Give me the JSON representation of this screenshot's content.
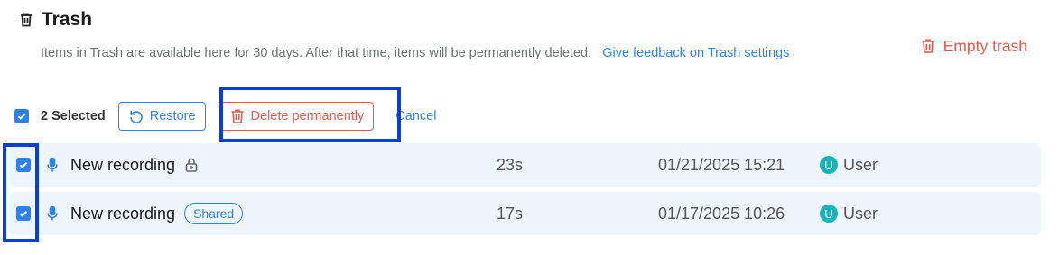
{
  "header": {
    "title": "Trash",
    "description": "Items in Trash are available here for 30 days. After that time, items will be permanently deleted.",
    "feedback_link": "Give feedback on Trash settings",
    "empty_trash_label": "Empty trash",
    "icon": "trash-icon"
  },
  "selection": {
    "count_label": "2 Selected",
    "restore_label": "Restore",
    "delete_label": "Delete permanently",
    "cancel_label": "Cancel"
  },
  "rows": [
    {
      "name": "New recording",
      "tag": "lock-icon",
      "duration": "23s",
      "date": "01/21/2025 15:21",
      "owner_initial": "U",
      "owner": "User",
      "checked": true
    },
    {
      "name": "New recording",
      "tag": "Shared",
      "duration": "17s",
      "date": "01/17/2025 10:26",
      "owner_initial": "U",
      "owner": "User",
      "checked": true
    }
  ],
  "colors": {
    "accent": "#2f80ed",
    "danger": "#e5584f",
    "row_bg": "#eef5fd",
    "avatar": "#17b3b8",
    "highlight": "#0a3fd6"
  }
}
